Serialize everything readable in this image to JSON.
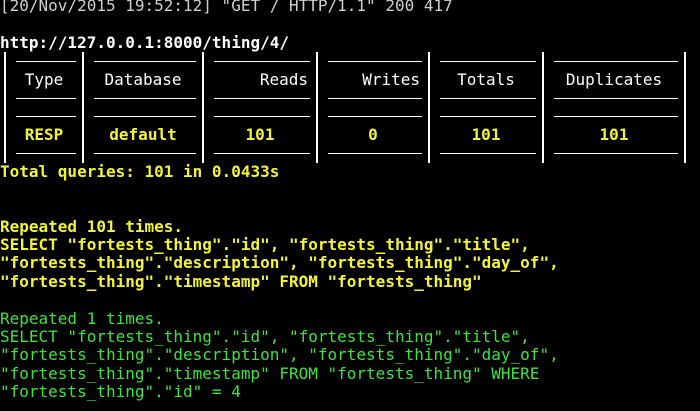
{
  "log": {
    "request_line": "[20/Nov/2015 19:52:12] \"GET / HTTP/1.1\" 200 417",
    "url": "http://127.0.0.1:8000/thing/4/"
  },
  "table": {
    "headers": [
      "Type",
      "Database",
      "Reads",
      "Writes",
      "Totals",
      "Duplicates"
    ],
    "row": [
      "RESP",
      "default",
      "101",
      "0",
      "101",
      "101"
    ]
  },
  "summary": "Total queries: 101 in 0.0433s",
  "blocks": [
    {
      "repeat": "Repeated 101 times.",
      "lines": [
        "SELECT \"fortests_thing\".\"id\", \"fortests_thing\".\"title\",",
        "\"fortests_thing\".\"description\", \"fortests_thing\".\"day_of\",",
        "\"fortests_thing\".\"timestamp\" FROM \"fortests_thing\""
      ]
    },
    {
      "repeat": "Repeated 1 times.",
      "lines": [
        "SELECT \"fortests_thing\".\"id\", \"fortests_thing\".\"title\",",
        "\"fortests_thing\".\"description\", \"fortests_thing\".\"day_of\",",
        "\"fortests_thing\".\"timestamp\" FROM \"fortests_thing\" WHERE",
        "\"fortests_thing\".\"id\" = 4"
      ]
    }
  ],
  "colors": {
    "background": "#000000",
    "yellow": "#f3f339",
    "green": "#3ee33e",
    "white": "#ffffff"
  }
}
